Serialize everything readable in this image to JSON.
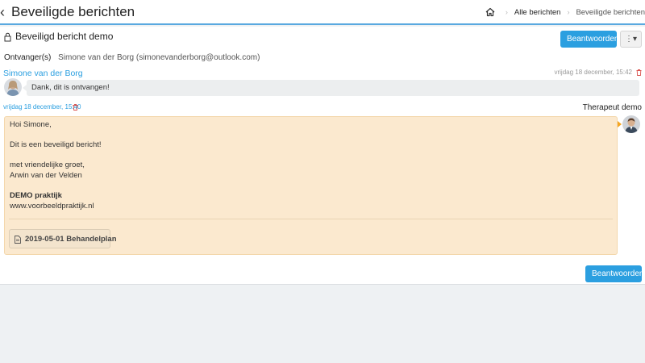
{
  "header": {
    "title": "Beveiligde berichten",
    "breadcrumb": {
      "items": [
        "Alle berichten",
        "Beveiligde berichten"
      ]
    }
  },
  "message": {
    "title": "Beveiligd bericht demo",
    "reply_label": "Beantwoorden",
    "recipients_label": "Ontvanger(s)",
    "recipients_value": "Simone van der Borg (simonevanderborg@outlook.com)"
  },
  "thread": [
    {
      "sender": "Simone van der Borg",
      "timestamp": "vrijdag 18 december, 15:42",
      "text": "Dank, dit is ontvangen!"
    },
    {
      "sender": "Therapeut demo",
      "timestamp": "vrijdag 18 december, 15:40",
      "lines": [
        "Hoi Simone,",
        "Dit is een beveiligd bericht!",
        "met vriendelijke groet,",
        "Arwin van der Velden",
        "DEMO praktijk",
        "www.voorbeeldpraktijk.nl"
      ],
      "attachment": "2019-05-01 Behandelplan"
    }
  ],
  "icons": {
    "back": "chevron-left-icon",
    "home": "home-icon",
    "lock": "lock-icon",
    "more": "kebab-icon",
    "delete": "trash-icon",
    "file": "file-icon"
  },
  "colors": {
    "accent": "#2b9fe0",
    "delete": "#d9534f",
    "message_bg": "#fbe9cf",
    "reply_bg": "#eceeef"
  }
}
